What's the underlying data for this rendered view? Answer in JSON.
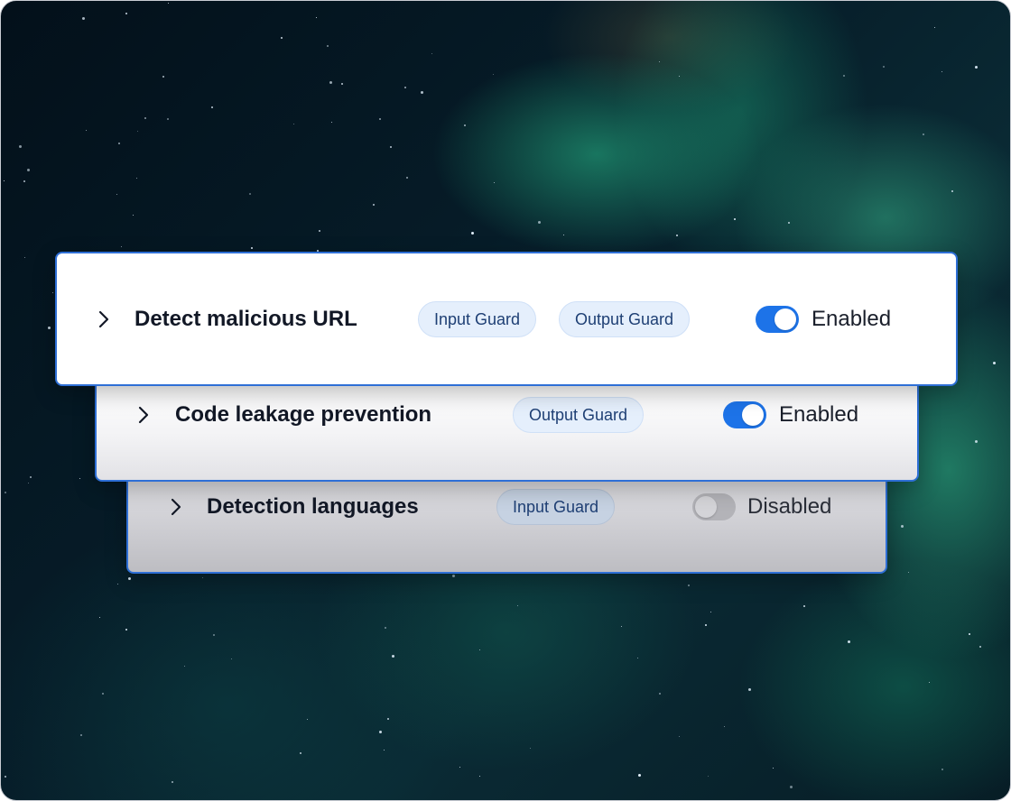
{
  "rules": [
    {
      "title": "Detect malicious URL",
      "tags": [
        "Input Guard",
        "Output Guard"
      ],
      "enabled": true,
      "status_label": "Enabled"
    },
    {
      "title": "Code leakage prevention",
      "tags": [
        "Output Guard"
      ],
      "enabled": true,
      "status_label": "Enabled"
    },
    {
      "title": "Detection languages",
      "tags": [
        "Input Guard"
      ],
      "enabled": false,
      "status_label": "Disabled"
    }
  ],
  "icons": {
    "expand": "chevron-right-icon"
  },
  "colors": {
    "accent": "#1d73e8",
    "card_border": "#2e6fd6",
    "tag_background": "#e5effc",
    "tag_text": "#1e3f74",
    "toggle_off": "#b3b3b8"
  }
}
